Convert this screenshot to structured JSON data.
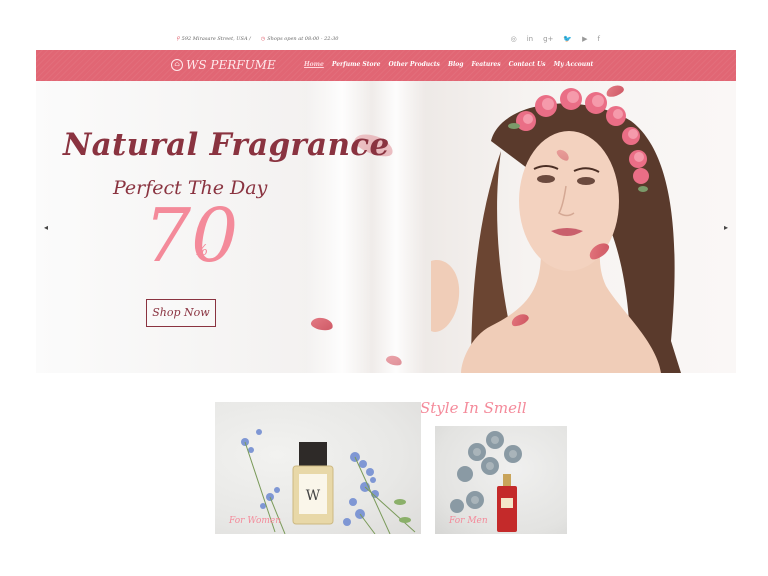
{
  "topbar": {
    "address": "592 Mirasare Street, USA",
    "hours": "Shops open at 08:00 - 22:30",
    "social_icons": [
      "instagram-icon",
      "linkedin-icon",
      "google-plus-icon",
      "twitter-icon",
      "youtube-icon",
      "facebook-icon"
    ]
  },
  "nav": {
    "logo_text": "WS PERFUME",
    "menu": [
      "Home",
      "Perfume Store",
      "Other Products",
      "Blog",
      "Features",
      "Contact Us",
      "My Account"
    ],
    "active_index": 0,
    "background_color": "#e16674"
  },
  "hero": {
    "title": "Natural Fragrance",
    "subtitle": "Perfect The Day",
    "number": "70",
    "percent": "%",
    "cta": "Shop Now",
    "prev_arrow": "◂",
    "next_arrow": "▸"
  },
  "categories": {
    "title": "Style In Smell",
    "cards": [
      {
        "label": "For Women",
        "bottle_text": "W"
      },
      {
        "label": "For Men"
      }
    ]
  },
  "colors": {
    "accent": "#f48a9a",
    "dark_text": "#8a3340"
  }
}
